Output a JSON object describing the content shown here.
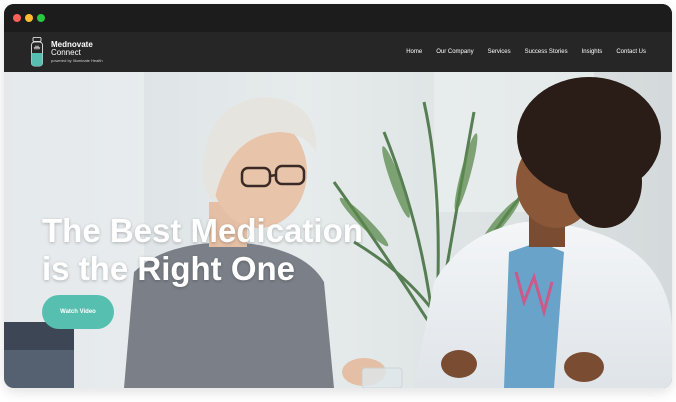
{
  "window": {
    "controls": [
      "close",
      "minimize",
      "maximize"
    ]
  },
  "brand": {
    "name": "Mednovate",
    "name_line2": "Connect",
    "powered_by": "powered by Illuminate Health",
    "logo_icon": "medication-bottle-icon",
    "accent_color": "#56bfb0"
  },
  "nav": {
    "items": [
      {
        "label": "Home"
      },
      {
        "label": "Our Company"
      },
      {
        "label": "Services"
      },
      {
        "label": "Success Stories"
      },
      {
        "label": "Insights"
      },
      {
        "label": "Contact Us"
      }
    ]
  },
  "hero": {
    "title_line1": "The Best Medication",
    "title_line2": "is the Right One",
    "cta_label": "Watch Video",
    "cta_color": "#56bfb0"
  }
}
